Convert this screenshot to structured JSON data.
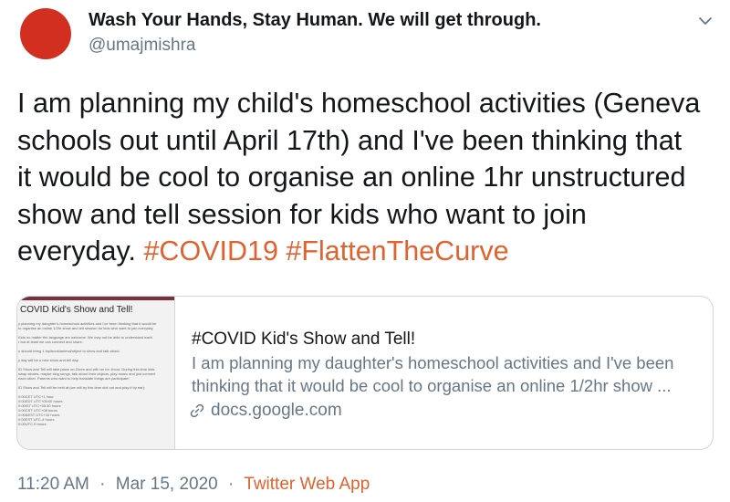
{
  "author": {
    "name": "Wash Your Hands, Stay Human. We will get through.",
    "handle": "@umajmishra",
    "avatar_color": "#d32f20"
  },
  "menu_icon": "chevron-down-icon",
  "tweet": {
    "lines": [
      "I am planning my child's homeschool activities (Geneva",
      "schools out until April 17th) and I've been thinking that",
      "it would be cool to organise an online 1hr unstructured",
      "show and tell session for kids who want to join"
    ],
    "last_line_text": "everyday.",
    "hashtags": [
      "#COVID19",
      "#FlattenTheCurve"
    ],
    "hashtag_color": "#e0622e"
  },
  "card": {
    "thumbnail_title": "COVID Kid's Show and Tell!",
    "thumbnail_lines": [
      "y planning my daughter's homeschool activities and I've been thinking that it would be",
      "to organise an online 1/2hr show and tell session for kids who want to join everyday.",
      "Kids no matter the language are welcome. We may not be able to understand each",
      "r but at least we can connect and share.",
      "u should bring 1 toy/book/animal/object to show and talk about.",
      "y day will be a new show and tell day.",
      "ID Show and Tell will take place on Zoom and will run for 1hour. During this time kids",
      "swap stories, maybe sing songs, talk about their objects, play music and just connect",
      "each other. Parents who want to help translate things are participate!",
      "ID Show and Tell will be held at (we will try this time slot out and play it by ear):",
      "0:00CET UTC+1 hour",
      "0:00EDT UTC+05:00 hours",
      "0:00IST UTC+05:30 hours",
      "0:00CST UTC+08 hours",
      "0:00AEST UTC+10 hours",
      "0:00EST UTC-4 hours",
      "0:00UTC 0 hours"
    ],
    "title": "#COVID Kid's Show and Tell!",
    "description_lines": [
      "I am planning my daughter's homeschool activities and I've been",
      "thinking that it would be cool to organise an online 1/2hr show ..."
    ],
    "link_icon": "link-icon",
    "domain": "docs.google.com"
  },
  "meta": {
    "time": "11:20 AM",
    "separator": "·",
    "date": "Mar 15, 2020",
    "app": "Twitter Web App",
    "app_color": "#e0622e"
  }
}
